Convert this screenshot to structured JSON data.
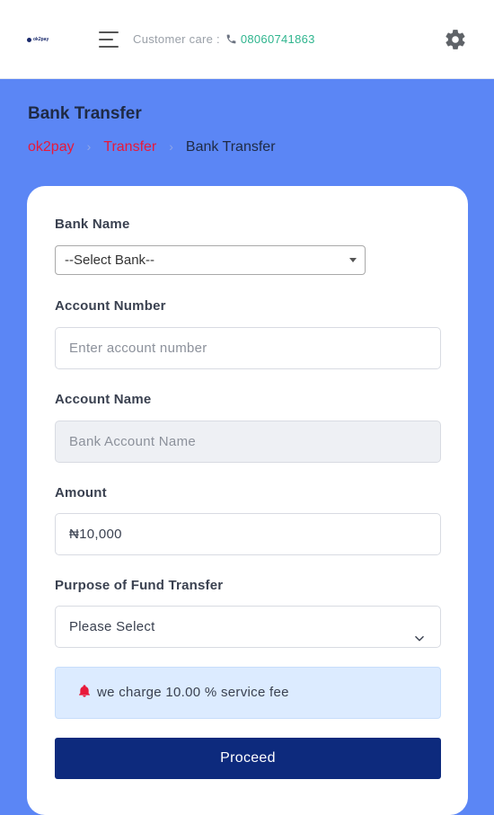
{
  "header": {
    "logo_text": "ok2pay",
    "customer_care_label": "Customer care :",
    "phone_number": "08060741863",
    "colors": {
      "phone": "#2fb58e"
    }
  },
  "page": {
    "title": "Bank Transfer",
    "breadcrumb": [
      "ok2pay",
      "Transfer",
      "Bank Transfer"
    ],
    "breadcrumb_separator": "›"
  },
  "form": {
    "bank_name": {
      "label": "Bank Name",
      "selected": "--Select Bank--"
    },
    "account_number": {
      "label": "Account Number",
      "placeholder": "Enter account number",
      "value": ""
    },
    "account_name": {
      "label": "Account Name",
      "placeholder": "Bank Account Name",
      "value": ""
    },
    "amount": {
      "label": "Amount",
      "value": "₦10,000"
    },
    "purpose": {
      "label": "Purpose of Fund Transfer",
      "selected": "Please Select"
    },
    "notice": "we charge 10.00 % service fee",
    "submit_label": "Proceed"
  },
  "theme": {
    "background": "#5b86f5",
    "breadcrumb_link": "#e8193a",
    "button": "#0d2a7d",
    "notice_bg": "#dcebff",
    "bell_icon": "#e8193a"
  },
  "icons": [
    "hamburger-menu-icon",
    "phone-icon",
    "gear-icon",
    "chevron-down-icon",
    "bell-icon"
  ]
}
